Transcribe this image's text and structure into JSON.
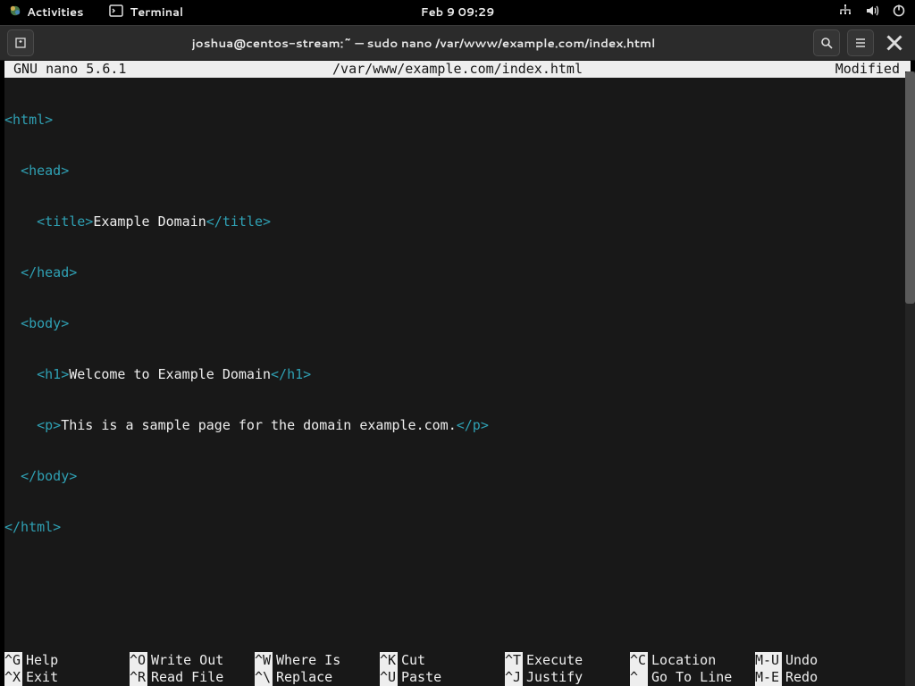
{
  "topbar": {
    "activities": "Activities",
    "app_label": "Terminal",
    "clock": "Feb 9  09:29"
  },
  "window": {
    "title": "joshua@centos-stream:~ — sudo nano /var/www/example.com/index.html"
  },
  "nano": {
    "version": "GNU nano 5.6.1",
    "filename": "/var/www/example.com/index.html",
    "status": "Modified"
  },
  "code": {
    "l1a": "<html>",
    "l2a": "  ",
    "l2b": "<head>",
    "l3a": "    ",
    "l3b": "<title>",
    "l3c": "Example Domain",
    "l3d": "</title>",
    "l4a": "  ",
    "l4b": "</head>",
    "l5a": "  ",
    "l5b": "<body>",
    "l6a": "    ",
    "l6b": "<h1>",
    "l6c": "Welcome to Example Domain",
    "l6d": "</h1>",
    "l7a": "    ",
    "l7b": "<p>",
    "l7c": "This is a sample page for the domain example.com.",
    "l7d": "</p>",
    "l8a": "  ",
    "l8b": "</body>",
    "l9a": "</html>"
  },
  "help": {
    "c1": {
      "k1": "^G",
      "l1": "Help",
      "k2": "^X",
      "l2": "Exit"
    },
    "c2": {
      "k1": "^O",
      "l1": "Write Out",
      "k2": "^R",
      "l2": "Read File"
    },
    "c3": {
      "k1": "^W",
      "l1": "Where Is",
      "k2": "^\\",
      "l2": "Replace"
    },
    "c4": {
      "k1": "^K",
      "l1": "Cut",
      "k2": "^U",
      "l2": "Paste"
    },
    "c5": {
      "k1": "^T",
      "l1": "Execute",
      "k2": "^J",
      "l2": "Justify"
    },
    "c6": {
      "k1": "^C",
      "l1": "Location",
      "k2": "^ ",
      "l2": "Go To Line"
    },
    "c7": {
      "k1": "M-U",
      "l1": "Undo",
      "k2": "M-E",
      "l2": "Redo"
    }
  }
}
